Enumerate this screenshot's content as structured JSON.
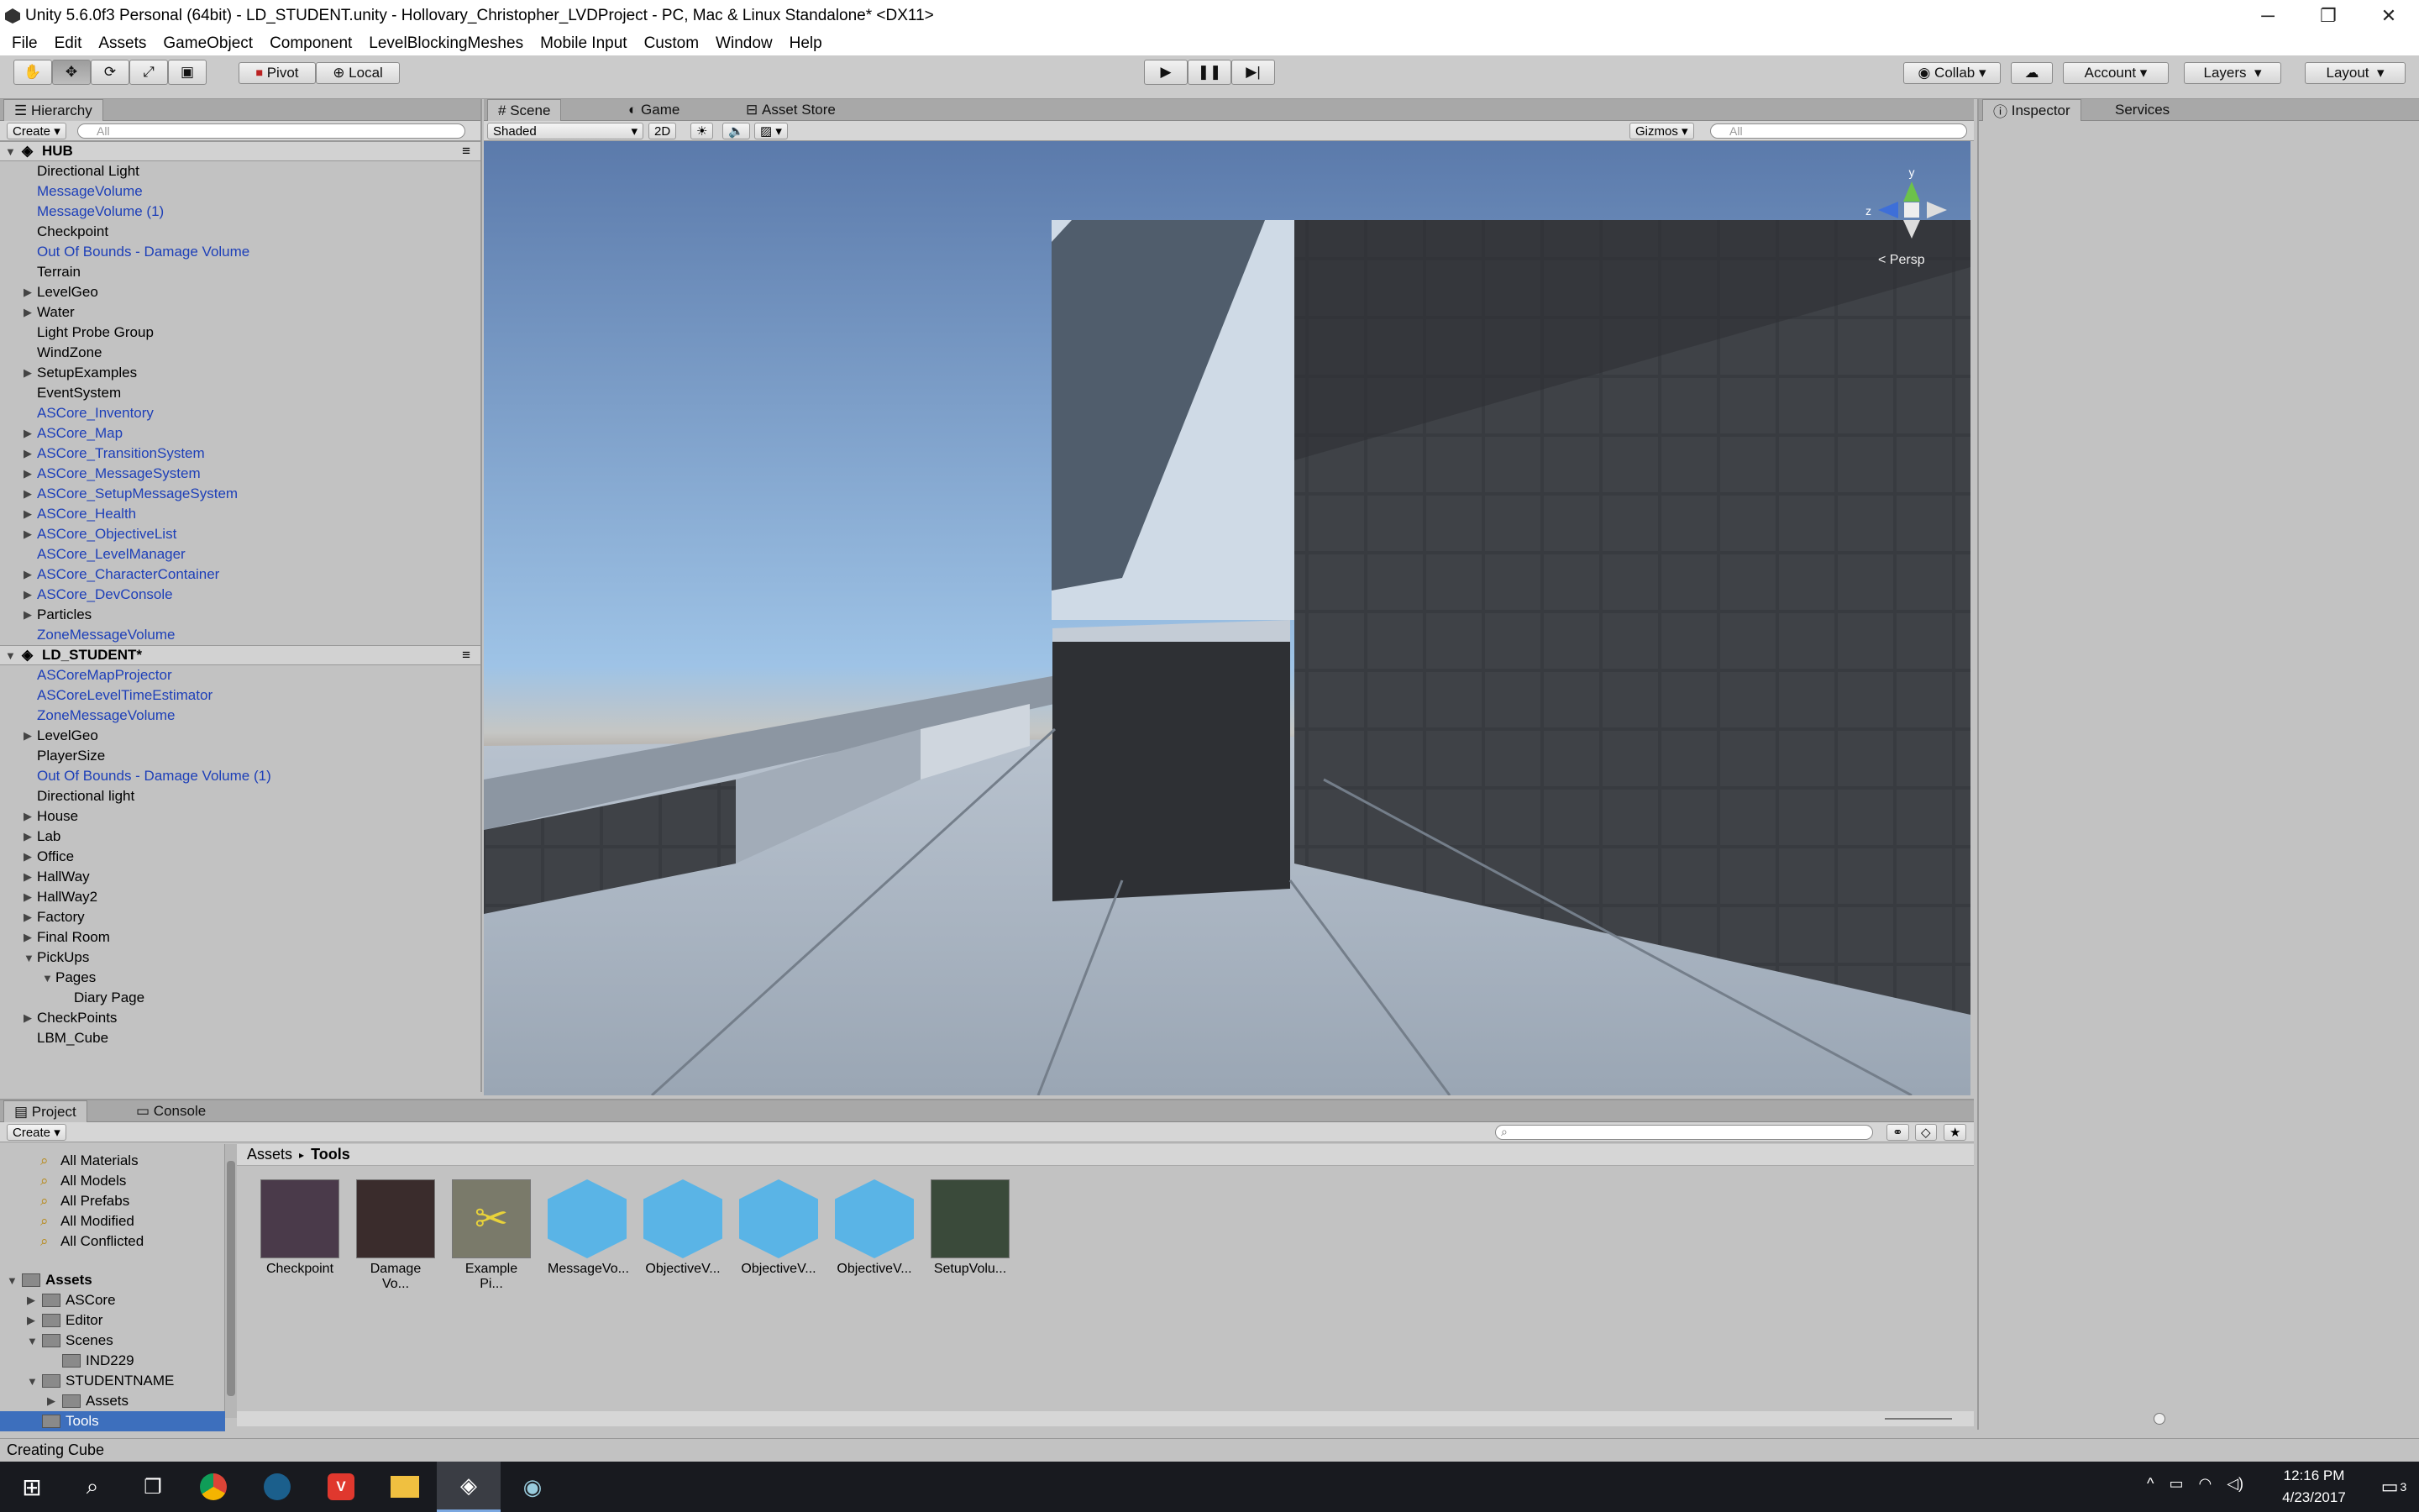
{
  "window": {
    "title": "Unity 5.6.0f3 Personal (64bit) - LD_STUDENT.unity - Hollovary_Christopher_LVDProject - PC, Mac & Linux Standalone* <DX11>"
  },
  "menu": [
    "File",
    "Edit",
    "Assets",
    "GameObject",
    "Component",
    "LevelBlockingMeshes",
    "Mobile Input",
    "Custom",
    "Window",
    "Help"
  ],
  "toolbar": {
    "pivot": "Pivot",
    "local": "Local",
    "collab": "Collab",
    "account": "Account",
    "layers": "Layers",
    "layout": "Layout"
  },
  "hierarchy": {
    "tab": "Hierarchy",
    "create": "Create",
    "search_placeholder": "All",
    "rows": [
      {
        "label": "HUB",
        "kind": "scene",
        "arrow": "down"
      },
      {
        "label": "Directional Light",
        "kind": "plain"
      },
      {
        "label": "MessageVolume",
        "kind": "blue"
      },
      {
        "label": "MessageVolume (1)",
        "kind": "blue"
      },
      {
        "label": "Checkpoint",
        "kind": "plain"
      },
      {
        "label": "Out Of Bounds - Damage Volume",
        "kind": "blue"
      },
      {
        "label": "Terrain",
        "kind": "plain"
      },
      {
        "label": "LevelGeo",
        "kind": "plain",
        "arrow": "right"
      },
      {
        "label": "Water",
        "kind": "plain",
        "arrow": "right"
      },
      {
        "label": "Light Probe Group",
        "kind": "plain"
      },
      {
        "label": "WindZone",
        "kind": "plain"
      },
      {
        "label": "SetupExamples",
        "kind": "plain",
        "arrow": "right"
      },
      {
        "label": "EventSystem",
        "kind": "plain"
      },
      {
        "label": "ASCore_Inventory",
        "kind": "blue"
      },
      {
        "label": "ASCore_Map",
        "kind": "blue",
        "arrow": "right"
      },
      {
        "label": "ASCore_TransitionSystem",
        "kind": "blue",
        "arrow": "right"
      },
      {
        "label": "ASCore_MessageSystem",
        "kind": "blue",
        "arrow": "right"
      },
      {
        "label": "ASCore_SetupMessageSystem",
        "kind": "blue",
        "arrow": "right"
      },
      {
        "label": "ASCore_Health",
        "kind": "blue",
        "arrow": "right"
      },
      {
        "label": "ASCore_ObjectiveList",
        "kind": "blue",
        "arrow": "right"
      },
      {
        "label": "ASCore_LevelManager",
        "kind": "blue"
      },
      {
        "label": "ASCore_CharacterContainer",
        "kind": "blue",
        "arrow": "right"
      },
      {
        "label": "ASCore_DevConsole",
        "kind": "blue",
        "arrow": "right"
      },
      {
        "label": "Particles",
        "kind": "plain",
        "arrow": "right"
      },
      {
        "label": "ZoneMessageVolume",
        "kind": "blue"
      },
      {
        "label": "LD_STUDENT*",
        "kind": "scene",
        "arrow": "down"
      },
      {
        "label": "ASCoreMapProjector",
        "kind": "blue"
      },
      {
        "label": "ASCoreLevelTimeEstimator",
        "kind": "blue"
      },
      {
        "label": "ZoneMessageVolume",
        "kind": "blue"
      },
      {
        "label": "LevelGeo",
        "kind": "plain",
        "arrow": "right"
      },
      {
        "label": "PlayerSize",
        "kind": "plain"
      },
      {
        "label": "Out Of Bounds - Damage Volume (1)",
        "kind": "blue"
      },
      {
        "label": "Directional light",
        "kind": "plain"
      },
      {
        "label": "House",
        "kind": "plain",
        "arrow": "right"
      },
      {
        "label": "Lab",
        "kind": "plain",
        "arrow": "right"
      },
      {
        "label": "Office",
        "kind": "plain",
        "arrow": "right"
      },
      {
        "label": "HallWay",
        "kind": "plain",
        "arrow": "right"
      },
      {
        "label": "HallWay2",
        "kind": "plain",
        "arrow": "right"
      },
      {
        "label": "Factory",
        "kind": "plain",
        "arrow": "right"
      },
      {
        "label": "Final Room",
        "kind": "plain",
        "arrow": "right"
      },
      {
        "label": "PickUps",
        "kind": "plain",
        "arrow": "down"
      },
      {
        "label": "Pages",
        "kind": "plain",
        "arrow": "down",
        "indent": 1
      },
      {
        "label": "Diary Page",
        "kind": "plain",
        "indent": 2
      },
      {
        "label": "CheckPoints",
        "kind": "plain",
        "arrow": "right"
      },
      {
        "label": "LBM_Cube",
        "kind": "plain"
      }
    ]
  },
  "scene": {
    "tabs": [
      "Scene",
      "Game",
      "Asset Store"
    ],
    "shading": "Shaded",
    "mode2d": "2D",
    "gizmos": "Gizmos",
    "search_placeholder": "All",
    "persp": "< Persp",
    "axis_y": "y",
    "axis_z": "z"
  },
  "inspector": {
    "tabs": [
      "Inspector",
      "Services"
    ]
  },
  "project": {
    "tabs": [
      "Project",
      "Console"
    ],
    "create": "Create",
    "favorites": [
      "All Materials",
      "All Models",
      "All Prefabs",
      "All Modified",
      "All Conflicted"
    ],
    "tree": [
      {
        "label": "Assets",
        "level": 0,
        "arrow": "down",
        "bold": true
      },
      {
        "label": "ASCore",
        "level": 1,
        "arrow": "right"
      },
      {
        "label": "Editor",
        "level": 1,
        "arrow": "right"
      },
      {
        "label": "Scenes",
        "level": 1,
        "arrow": "down"
      },
      {
        "label": "IND229",
        "level": 2
      },
      {
        "label": "STUDENTNAME",
        "level": 1,
        "arrow": "down"
      },
      {
        "label": "Assets",
        "level": 2,
        "arrow": "right"
      },
      {
        "label": "Tools",
        "level": 1,
        "selected": true
      }
    ],
    "breadcrumb": {
      "root": "Assets",
      "current": "Tools"
    },
    "assets": [
      {
        "label": "Checkpoint",
        "color": "#4a3a4a"
      },
      {
        "label": "Damage Vo...",
        "color": "#3a2c2c"
      },
      {
        "label": "Example Pi...",
        "color": "#7a7a6a"
      },
      {
        "label": "MessageVo...",
        "color": "#5ab4e6"
      },
      {
        "label": "ObjectiveV...",
        "color": "#5ab4e6"
      },
      {
        "label": "ObjectiveV...",
        "color": "#5ab4e6"
      },
      {
        "label": "ObjectiveV...",
        "color": "#5ab4e6"
      },
      {
        "label": "SetupVolu...",
        "color": "#3a4a3a"
      }
    ]
  },
  "status": {
    "text": "Creating Cube"
  },
  "taskbar": {
    "time": "12:16 PM",
    "date": "4/23/2017",
    "notif": "3"
  }
}
